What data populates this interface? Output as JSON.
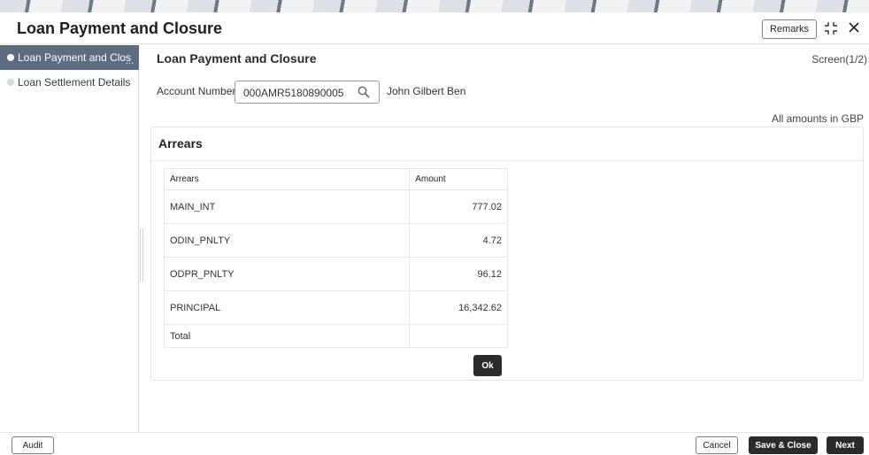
{
  "header": {
    "title": "Loan Payment and Closure",
    "remarks_label": "Remarks"
  },
  "sidebar": {
    "items": [
      {
        "label": "Loan Payment and Clos",
        "active": true
      },
      {
        "label": "Loan Settlement Details",
        "active": false
      }
    ],
    "overflow_mark": "..."
  },
  "main": {
    "title": "Loan Payment and Closure",
    "screen_indicator": "Screen(1/2)",
    "account_label": "Account Number",
    "account_value": "000AMR5180890005",
    "account_holder": "John Gilbert Ben",
    "amounts_note": "All amounts in GBP"
  },
  "arrears_panel": {
    "title": "Arrears",
    "columns": [
      "Arrears",
      "Amount"
    ],
    "rows": [
      {
        "arrear": "MAIN_INT",
        "amount": "777.02"
      },
      {
        "arrear": "ODIN_PNLTY",
        "amount": "4.72"
      },
      {
        "arrear": "ODPR_PNLTY",
        "amount": "96.12"
      },
      {
        "arrear": "PRINCIPAL",
        "amount": "16,342.62"
      }
    ],
    "total_label": "Total",
    "total_amount": "",
    "ok_label": "Ok"
  },
  "footer": {
    "audit_label": "Audit",
    "cancel_label": "Cancel",
    "save_close_label": "Save & Close",
    "next_label": "Next"
  },
  "colors": {
    "accent_dark": "#2b2b2b",
    "sidebar_active": "#5c6d82"
  },
  "icons": [
    "shrink-icon",
    "close-icon",
    "search-icon"
  ]
}
